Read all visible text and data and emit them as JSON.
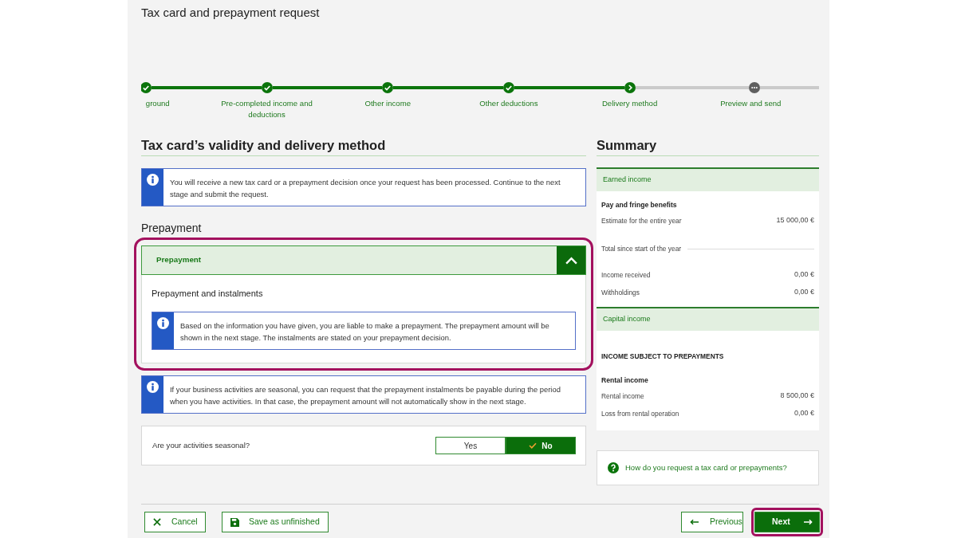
{
  "page": {
    "title": "Tax card and prepayment request"
  },
  "stepper": {
    "steps": [
      {
        "label": "ground",
        "completed": true,
        "current": false
      },
      {
        "label": "Pre-completed income and deductions",
        "completed": true,
        "current": false
      },
      {
        "label": "Other income",
        "completed": true,
        "current": false
      },
      {
        "label": "Other deductions",
        "completed": true,
        "current": false
      },
      {
        "label": "Delivery method",
        "completed": false,
        "current": true
      },
      {
        "label": "Preview and send",
        "completed": false,
        "current": false
      }
    ]
  },
  "main": {
    "heading": "Tax card’s validity and delivery method",
    "info": "You will receive a new tax card or a prepayment decision once your request has been processed. Continue to the next stage and submit the request.",
    "section_heading": "Prepayment",
    "accordion": {
      "title": "Prepayment",
      "expanded": true,
      "highlighted": true,
      "subheading": "Prepayment and instalments",
      "info": "Based on the information you have given, you are liable to make a prepayment. The prepayment amount will be shown in the next stage. The instalments are stated on your prepayment decision."
    },
    "seasonal_info": "If your business activities are seasonal, you can request that the prepayment instalments be payable during the period when you have activities. In that case, the prepayment amount will not automatically show in the next stage.",
    "question": {
      "label": "Are your activities seasonal?",
      "options": [
        {
          "label": "Yes",
          "selected": false
        },
        {
          "label": "No",
          "selected": true
        }
      ]
    }
  },
  "summary": {
    "heading": "Summary",
    "sections": [
      {
        "title": "Earned income",
        "items": [
          {
            "kind": "group",
            "label": "Pay and fringe benefits"
          },
          {
            "kind": "value",
            "label": "Estimate for the entire year",
            "value": "15 000,00 €"
          },
          {
            "kind": "subhead",
            "label": "Total since start of the year"
          },
          {
            "kind": "value",
            "label": "Income received",
            "value": "0,00 €"
          },
          {
            "kind": "value",
            "label": "Withholdings",
            "value": "0,00 €"
          }
        ]
      },
      {
        "title": "Capital income",
        "items": [
          {
            "kind": "category",
            "label": "INCOME SUBJECT TO PREPAYMENTS"
          },
          {
            "kind": "group",
            "label": "Rental income"
          },
          {
            "kind": "value",
            "label": "Rental income",
            "value": "8 500,00 €"
          },
          {
            "kind": "value",
            "label": "Loss from rental operation",
            "value": "0,00 €"
          }
        ]
      }
    ],
    "help_link": "How do you request a tax card or prepayments?"
  },
  "footer": {
    "left_buttons": [
      {
        "kind": "cancel",
        "label": "Cancel",
        "highlighted": false
      },
      {
        "kind": "save",
        "label": "Save as unfinished",
        "highlighted": false
      }
    ],
    "right_buttons": [
      {
        "kind": "previous",
        "label": "Previous",
        "highlighted": false
      },
      {
        "kind": "next",
        "label": "Next",
        "highlighted": true
      }
    ]
  }
}
